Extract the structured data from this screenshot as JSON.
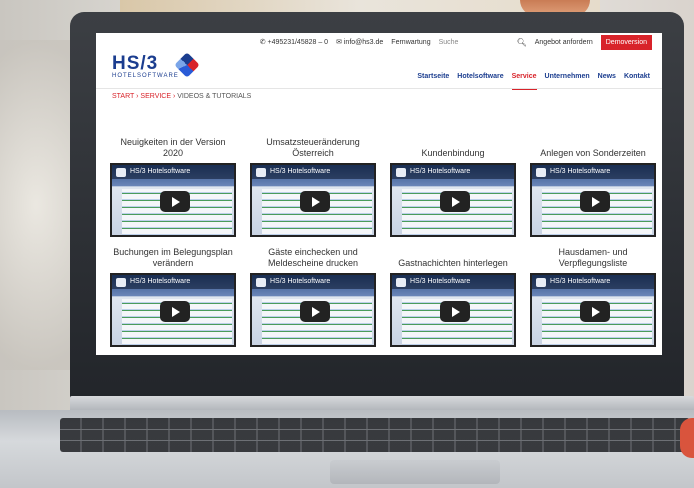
{
  "topbar": {
    "phone": "✆ +495231/45828 – 0",
    "email": "✉ info@hs3.de",
    "fernwartung": "Fernwartung",
    "search_placeholder": "Suche",
    "angebot": "Angebot anfordern",
    "demo": "Demoversion"
  },
  "logo": {
    "main": "HS/3",
    "sub": "HOTELSOFTWARE"
  },
  "nav": [
    "Startseite",
    "Hotelsoftware",
    "Service",
    "Unternehmen",
    "News",
    "Kontakt"
  ],
  "breadcrumb": {
    "start": "START",
    "service": "SERVICE",
    "current": "VIDEOS & TUTORIALS"
  },
  "videos": [
    {
      "title": "Neuigkeiten in der Version 2020",
      "channel": "HS/3 Hotelsoftware"
    },
    {
      "title": "Umsatzsteueränderung Österreich",
      "channel": "HS/3 Hotelsoftware"
    },
    {
      "title": "Kundenbindung",
      "channel": "HS/3 Hotelsoftware"
    },
    {
      "title": "Anlegen von Sonderzeiten",
      "channel": "HS/3 Hotelsoftware"
    },
    {
      "title": "Buchungen im Belegungsplan verändern",
      "channel": "HS/3 Hotelsoftware"
    },
    {
      "title": "Gäste einchecken und Meldescheine drucken",
      "channel": "HS/3 Hotelsoftware"
    },
    {
      "title": "Gastnachichten hinterlegen",
      "channel": "HS/3 Hotelsoftware"
    },
    {
      "title": "Hausdamen- und Verpflegungsliste",
      "channel": "HS/3 Hotelsoftware"
    }
  ],
  "colors": {
    "brand_blue": "#1b3d8f",
    "brand_red": "#d8232a"
  },
  "icons": {
    "search": "search-icon",
    "play": "play-icon"
  }
}
